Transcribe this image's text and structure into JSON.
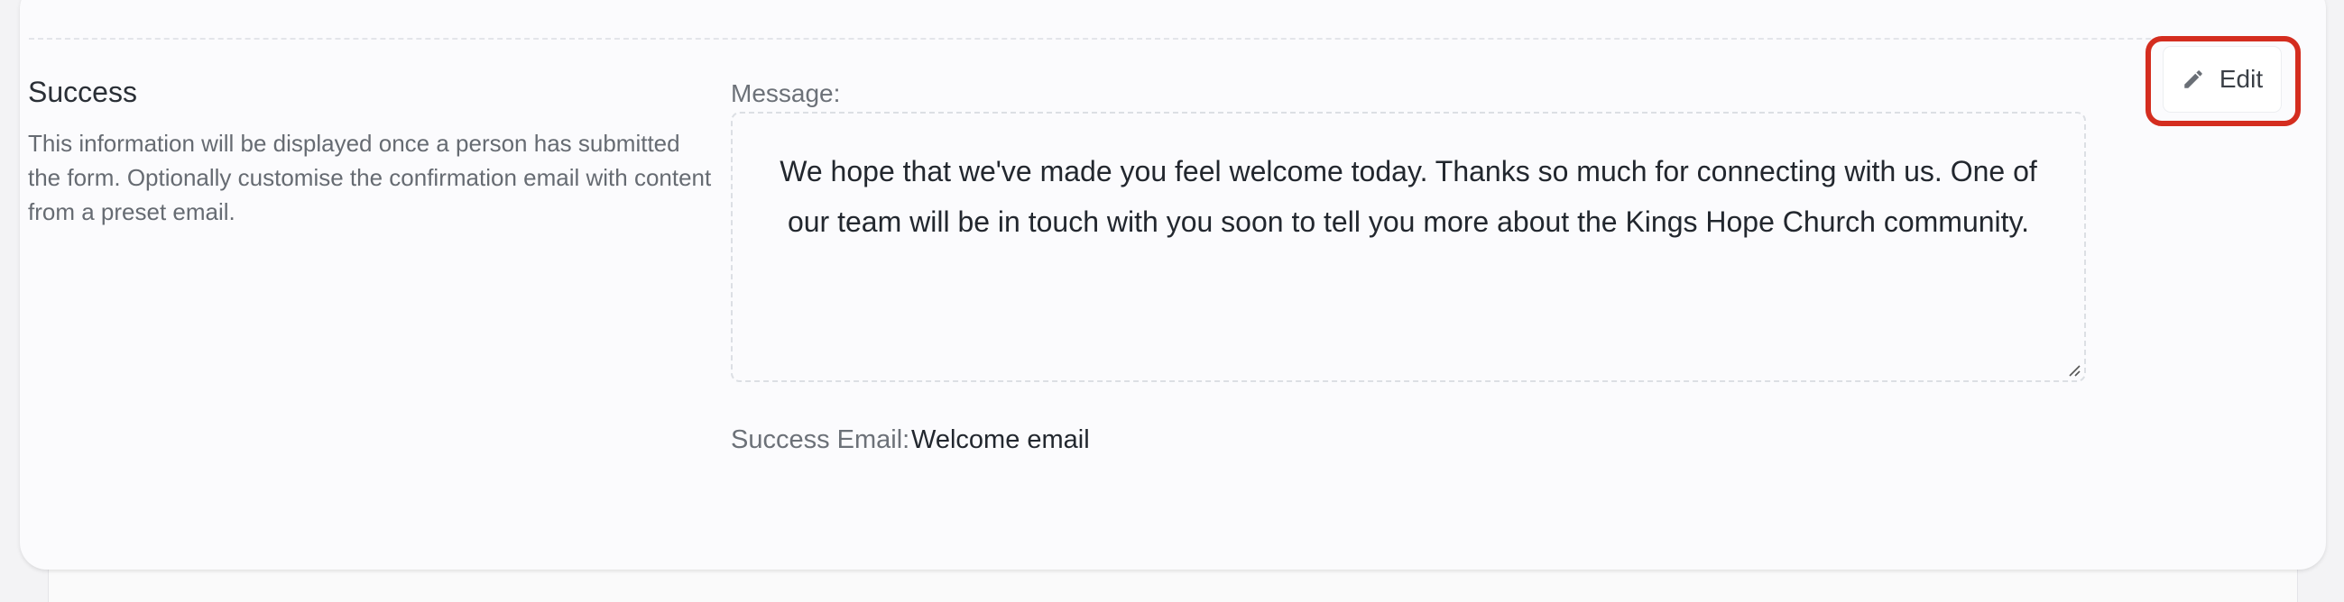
{
  "success_section": {
    "title": "Success",
    "description": "This information will be displayed once a person has submitted the form. Optionally customise the confirmation email with content from a preset email.",
    "message_label": "Message:",
    "message": "We hope that we've made you feel welcome today. Thanks so much for connecting with us. One of our team will be in touch with you soon to tell you more about the Kings Hope Church community.",
    "success_email_label": "Success Email:",
    "success_email_value": "Welcome email"
  },
  "toolbar": {
    "edit_label": "Edit",
    "edit_icon": "pencil-icon"
  },
  "colors": {
    "highlight": "#d42d1f",
    "page_background": "#f3f3f5",
    "card_background": "#fbfbfd"
  }
}
